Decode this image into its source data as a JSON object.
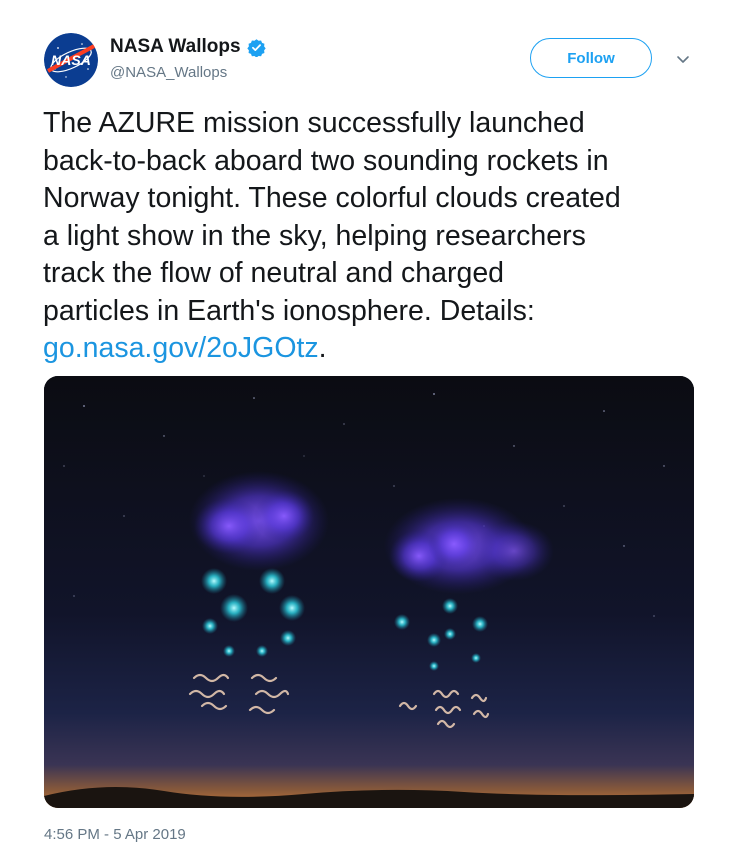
{
  "user": {
    "display_name": "NASA Wallops",
    "handle": "@NASA_Wallops",
    "avatar_logo_text": "NASA",
    "verified": true
  },
  "follow_label": "Follow",
  "tweet": {
    "text_before_link": "The AZURE mission successfully launched\nback-to-back aboard two sounding rockets in\nNorway tonight. These colorful clouds created\na light show in the sky, helping researchers\ntrack the flow of neutral and charged\nparticles in Earth's ionosphere. Details:\n",
    "link": "go.nasa.gov/2oJGOtz",
    "text_after_link": "."
  },
  "timestamp": "4:56 PM - 5 Apr 2019",
  "icons": {
    "verified": "verified-badge-icon",
    "caret": "chevron-down-icon"
  },
  "colors": {
    "accent": "#1da1f2",
    "link": "#1b95e0",
    "muted": "#657786",
    "nasa_blue": "#0b3d91",
    "nasa_red": "#fc3d21"
  }
}
